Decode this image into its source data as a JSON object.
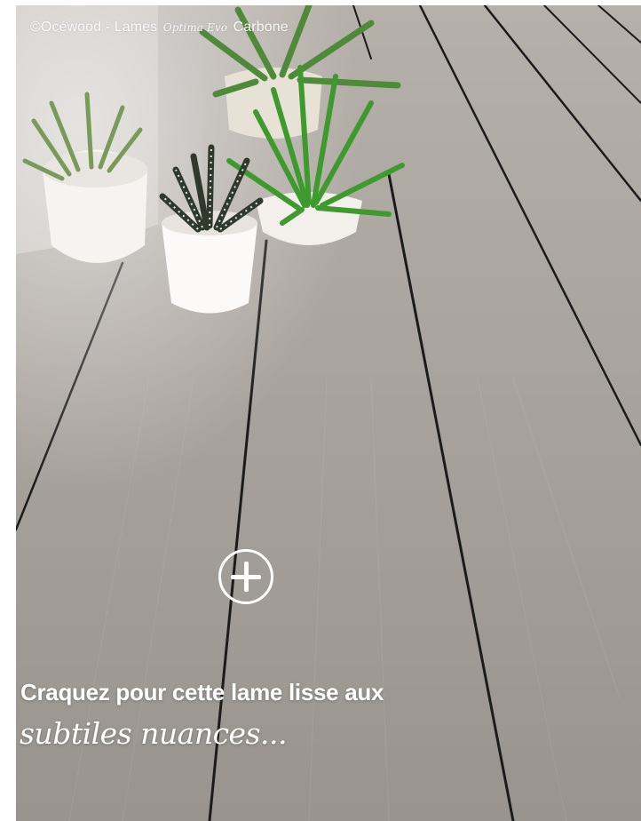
{
  "photo": {
    "credit_prefix": "©Océwood - Lames",
    "credit_script": "Optima Evo",
    "credit_suffix": "Carbone"
  },
  "overlay": {
    "headline": "Craquez pour cette lame lisse aux",
    "subline": "subtiles nuances..."
  },
  "colors": {
    "deck": "#a39e98",
    "gap": "#1b1b1b",
    "text": "#ffffff"
  },
  "icons": {
    "expand": "plus-circle-icon"
  }
}
